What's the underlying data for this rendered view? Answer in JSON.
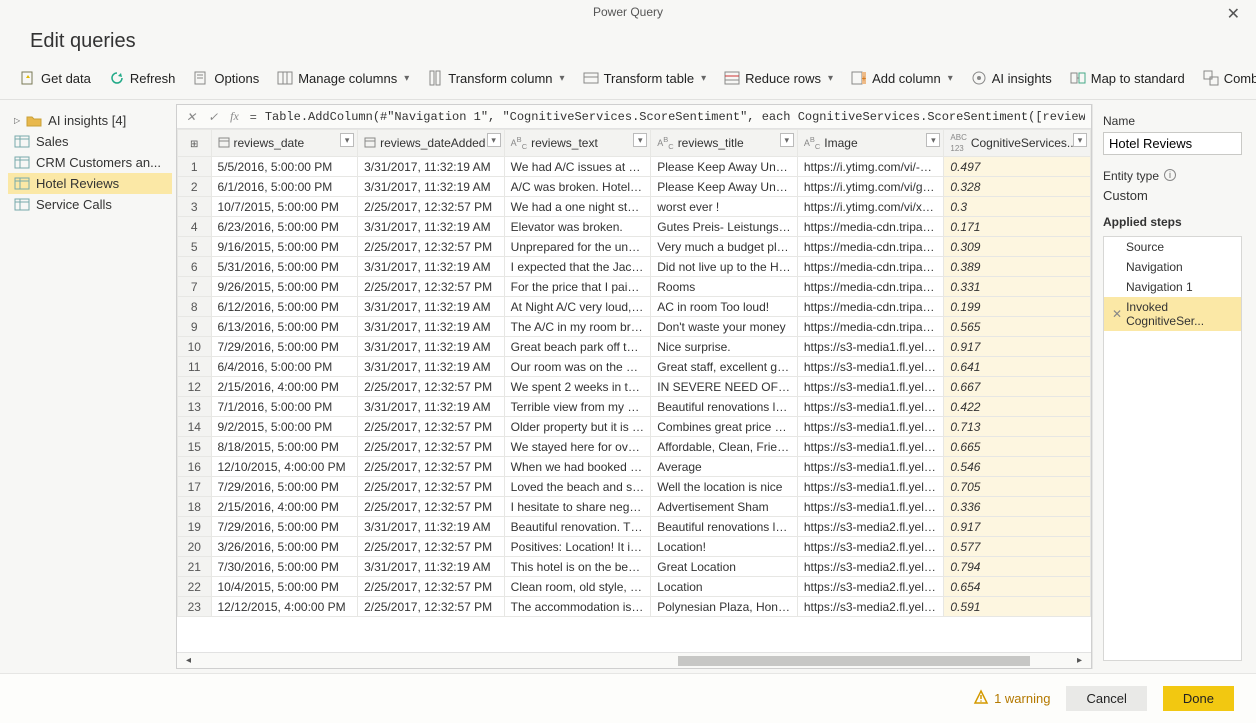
{
  "window": {
    "app_title": "Power Query",
    "page_title": "Edit queries"
  },
  "toolbar": {
    "get_data": "Get data",
    "refresh": "Refresh",
    "options": "Options",
    "manage_columns": "Manage columns",
    "transform_column": "Transform column",
    "transform_table": "Transform table",
    "reduce_rows": "Reduce rows",
    "add_column": "Add column",
    "ai_insights": "AI insights",
    "map_to_standard": "Map to standard",
    "combine_tables": "Combine tables"
  },
  "sidebar": {
    "items": [
      {
        "label": "AI insights [4]",
        "type": "folder"
      },
      {
        "label": "Sales",
        "type": "table"
      },
      {
        "label": "CRM Customers an...",
        "type": "table"
      },
      {
        "label": "Hotel Reviews",
        "type": "table",
        "selected": true
      },
      {
        "label": "Service Calls",
        "type": "table"
      }
    ]
  },
  "formula": "Table.AddColumn(#\"Navigation 1\", \"CognitiveServices.ScoreSentiment\", each CognitiveServices.ScoreSentiment([reviews_text], \"en\"))",
  "columns": [
    {
      "label": "reviews_date",
      "type": "calendar"
    },
    {
      "label": "reviews_dateAdded",
      "type": "calendar"
    },
    {
      "label": "reviews_text",
      "type": "text"
    },
    {
      "label": "reviews_title",
      "type": "text"
    },
    {
      "label": "Image",
      "type": "text"
    },
    {
      "label": "CognitiveServices....",
      "type": "abc123",
      "highlight": true
    }
  ],
  "rows": [
    {
      "n": 1,
      "d": "5/5/2016, 5:00:00 PM",
      "a": "3/31/2017, 11:32:19 AM",
      "t": "We had A/C issues at 3:30 ...",
      "ti": "Please Keep Away Until Co...",
      "im": "https://i.ytimg.com/vi/-3sD...",
      "s": "0.497"
    },
    {
      "n": 2,
      "d": "6/1/2016, 5:00:00 PM",
      "a": "3/31/2017, 11:32:19 AM",
      "t": "A/C was broken. Hotel was...",
      "ti": "Please Keep Away Until Co...",
      "im": "https://i.ytimg.com/vi/gV...",
      "s": "0.328"
    },
    {
      "n": 3,
      "d": "10/7/2015, 5:00:00 PM",
      "a": "2/25/2017, 12:32:57 PM",
      "t": "We had a one night stay at...",
      "ti": "worst ever !",
      "im": "https://i.ytimg.com/vi/xcEB...",
      "s": "0.3"
    },
    {
      "n": 4,
      "d": "6/23/2016, 5:00:00 PM",
      "a": "3/31/2017, 11:32:19 AM",
      "t": "Elevator was broken.",
      "ti": "Gutes Preis- Leistungsverh...",
      "im": "https://media-cdn.tripadvi...",
      "s": "0.171"
    },
    {
      "n": 5,
      "d": "9/16/2015, 5:00:00 PM",
      "a": "2/25/2017, 12:32:57 PM",
      "t": "Unprepared for the unwelc...",
      "ti": "Very much a budget place",
      "im": "https://media-cdn.tripadvi...",
      "s": "0.309"
    },
    {
      "n": 6,
      "d": "5/31/2016, 5:00:00 PM",
      "a": "3/31/2017, 11:32:19 AM",
      "t": "I expected that the Jacuzzi ...",
      "ti": "Did not live up to the Hilto...",
      "im": "https://media-cdn.tripadvi...",
      "s": "0.389"
    },
    {
      "n": 7,
      "d": "9/26/2015, 5:00:00 PM",
      "a": "2/25/2017, 12:32:57 PM",
      "t": "For the price that I paid for...",
      "ti": "Rooms",
      "im": "https://media-cdn.tripadvi...",
      "s": "0.331"
    },
    {
      "n": 8,
      "d": "6/12/2016, 5:00:00 PM",
      "a": "3/31/2017, 11:32:19 AM",
      "t": "At Night A/C very loud, als...",
      "ti": "AC in room Too loud!",
      "im": "https://media-cdn.tripadvi...",
      "s": "0.199"
    },
    {
      "n": 9,
      "d": "6/13/2016, 5:00:00 PM",
      "a": "3/31/2017, 11:32:19 AM",
      "t": "The A/C in my room broke...",
      "ti": "Don't waste your money",
      "im": "https://media-cdn.tripadvi...",
      "s": "0.565"
    },
    {
      "n": 10,
      "d": "7/29/2016, 5:00:00 PM",
      "a": "3/31/2017, 11:32:19 AM",
      "t": "Great beach park off the la...",
      "ti": "Nice surprise.",
      "im": "https://s3-media1.fl.yelpcd...",
      "s": "0.917"
    },
    {
      "n": 11,
      "d": "6/4/2016, 5:00:00 PM",
      "a": "3/31/2017, 11:32:19 AM",
      "t": "Our room was on the bott...",
      "ti": "Great staff, excellent getaw...",
      "im": "https://s3-media1.fl.yelpcd...",
      "s": "0.641"
    },
    {
      "n": 12,
      "d": "2/15/2016, 4:00:00 PM",
      "a": "2/25/2017, 12:32:57 PM",
      "t": "We spent 2 weeks in this h...",
      "ti": "IN SEVERE NEED OF UPDA...",
      "im": "https://s3-media1.fl.yelpcd...",
      "s": "0.667"
    },
    {
      "n": 13,
      "d": "7/1/2016, 5:00:00 PM",
      "a": "3/31/2017, 11:32:19 AM",
      "t": "Terrible view from my $300...",
      "ti": "Beautiful renovations locat...",
      "im": "https://s3-media1.fl.yelpcd...",
      "s": "0.422"
    },
    {
      "n": 14,
      "d": "9/2/2015, 5:00:00 PM",
      "a": "2/25/2017, 12:32:57 PM",
      "t": "Older property but it is su...",
      "ti": "Combines great price with ...",
      "im": "https://s3-media1.fl.yelpcd...",
      "s": "0.713"
    },
    {
      "n": 15,
      "d": "8/18/2015, 5:00:00 PM",
      "a": "2/25/2017, 12:32:57 PM",
      "t": "We stayed here for over a ...",
      "ti": "Affordable, Clean, Friendly ...",
      "im": "https://s3-media1.fl.yelpcd...",
      "s": "0.665"
    },
    {
      "n": 16,
      "d": "12/10/2015, 4:00:00 PM",
      "a": "2/25/2017, 12:32:57 PM",
      "t": "When we had booked this ...",
      "ti": "Average",
      "im": "https://s3-media1.fl.yelpcd...",
      "s": "0.546"
    },
    {
      "n": 17,
      "d": "7/29/2016, 5:00:00 PM",
      "a": "2/25/2017, 12:32:57 PM",
      "t": "Loved the beach and service",
      "ti": "Well the location is nice",
      "im": "https://s3-media1.fl.yelpcd...",
      "s": "0.705"
    },
    {
      "n": 18,
      "d": "2/15/2016, 4:00:00 PM",
      "a": "2/25/2017, 12:32:57 PM",
      "t": "I hesitate to share negative...",
      "ti": "Advertisement Sham",
      "im": "https://s3-media1.fl.yelpcd...",
      "s": "0.336"
    },
    {
      "n": 19,
      "d": "7/29/2016, 5:00:00 PM",
      "a": "3/31/2017, 11:32:19 AM",
      "t": "Beautiful renovation. The h...",
      "ti": "Beautiful renovations locat...",
      "im": "https://s3-media2.fl.yelpcd...",
      "s": "0.917"
    },
    {
      "n": 20,
      "d": "3/26/2016, 5:00:00 PM",
      "a": "2/25/2017, 12:32:57 PM",
      "t": "Positives: Location! It is on ...",
      "ti": "Location!",
      "im": "https://s3-media2.fl.yelpcd...",
      "s": "0.577"
    },
    {
      "n": 21,
      "d": "7/30/2016, 5:00:00 PM",
      "a": "3/31/2017, 11:32:19 AM",
      "t": "This hotel is on the beach ...",
      "ti": "Great Location",
      "im": "https://s3-media2.fl.yelpcd...",
      "s": "0.794"
    },
    {
      "n": 22,
      "d": "10/4/2015, 5:00:00 PM",
      "a": "2/25/2017, 12:32:57 PM",
      "t": "Clean room, old style, 196...",
      "ti": "Location",
      "im": "https://s3-media2.fl.yelpcd...",
      "s": "0.654"
    },
    {
      "n": 23,
      "d": "12/12/2015, 4:00:00 PM",
      "a": "2/25/2017, 12:32:57 PM",
      "t": "The accommodation is bas...",
      "ti": "Polynesian Plaza, Honolulu",
      "im": "https://s3-media2.fl.yelpcd...",
      "s": "0.591"
    }
  ],
  "rightpane": {
    "name_label": "Name",
    "name_value": "Hotel Reviews",
    "entity_type_label": "Entity type",
    "entity_type_value": "Custom",
    "applied_steps_label": "Applied steps",
    "steps": [
      {
        "label": "Source"
      },
      {
        "label": "Navigation"
      },
      {
        "label": "Navigation 1"
      },
      {
        "label": "Invoked CognitiveSer...",
        "selected": true,
        "removable": true
      }
    ]
  },
  "footer": {
    "warning": "1 warning",
    "cancel": "Cancel",
    "done": "Done"
  }
}
